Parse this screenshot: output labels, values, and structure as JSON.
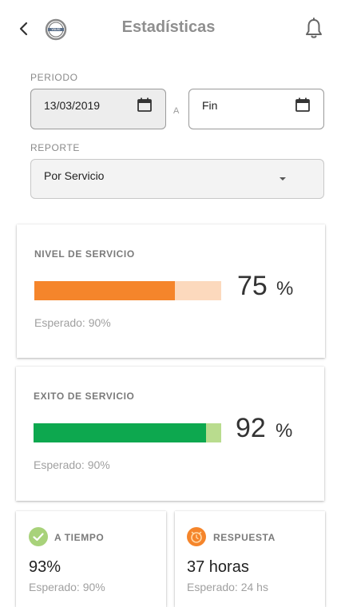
{
  "header": {
    "title": "Estadísticas",
    "back_icon": "back-arrow-icon",
    "logo": "volvo-logo",
    "notif_icon": "bell-icon"
  },
  "periodo": {
    "label": "PERIODO",
    "start_value": "13/03/2019",
    "separator": "A",
    "end_value": "Fin"
  },
  "reporte": {
    "label": "REPORTE",
    "selected": "Por Servicio"
  },
  "nivel": {
    "title": "NIVEL DE SERVICIO",
    "value": "75",
    "unit": "%",
    "progress": 0.75,
    "expected": "Esperado: 90%",
    "fill_color": "#f5852b",
    "track_color": "#fcd9bd"
  },
  "exito": {
    "title": "EXITO DE SERVICIO",
    "value": "92",
    "unit": "%",
    "progress": 0.92,
    "expected": "Esperado: 90%",
    "fill_color": "#0da84f",
    "track_color": "#b9dc8e"
  },
  "a_tiempo": {
    "title": "A TIEMPO",
    "value": "93%",
    "expected": "Esperado: 90%",
    "icon": "check-icon",
    "badge_color": "#a8d27a"
  },
  "respuesta": {
    "title": "RESPUESTA",
    "value": "37 horas",
    "expected": "Esperado: 24 hs",
    "icon": "alarm-clock-icon",
    "badge_color": "#f5852b"
  }
}
